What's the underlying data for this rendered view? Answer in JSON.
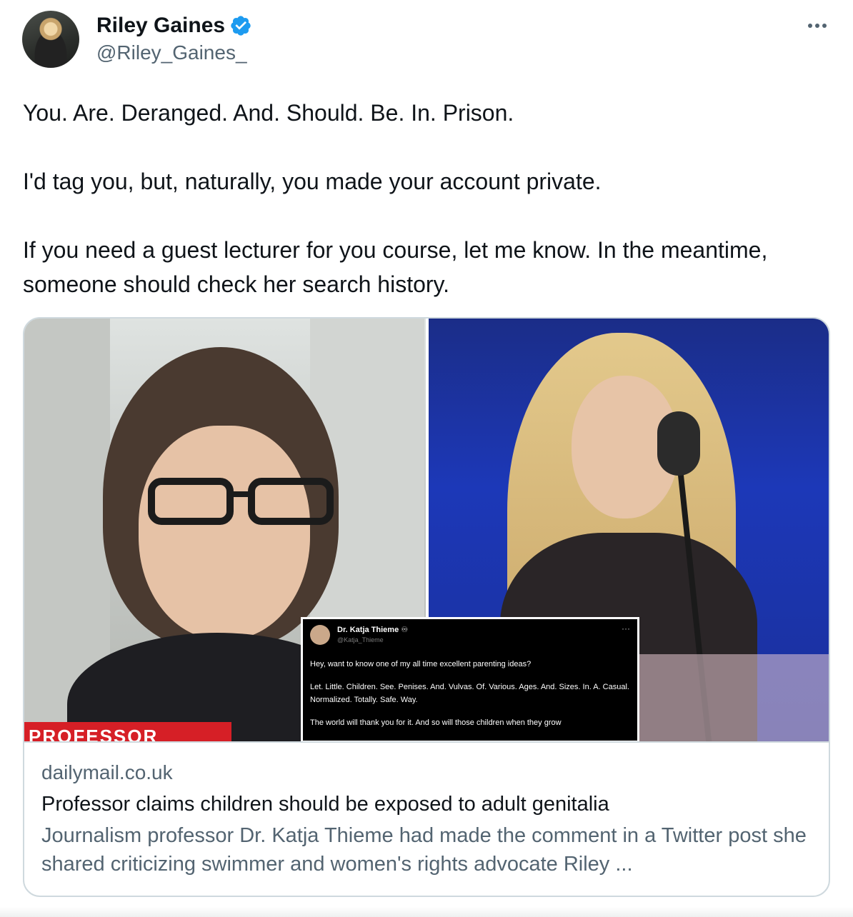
{
  "author": {
    "display_name": "Riley Gaines",
    "handle": "@Riley_Gaines_",
    "verified": true,
    "avatar_icon": "avatar-photo"
  },
  "tweet": {
    "paragraphs": [
      "You. Are. Deranged. And. Should. Be. In. Prison.",
      "I'd tag you, but, naturally, you made your account private.",
      "If you need a guest lecturer for you course, let me know. In the meantime, someone should check her search history."
    ]
  },
  "card": {
    "image_banner": "PROFESSOR",
    "embedded_tweet": {
      "name": "Dr. Katja Thieme ♾",
      "handle": "@Katja_Thieme",
      "lines": [
        "Hey, want to know one of my all time excellent parenting ideas?",
        "Let. Little. Children. See. Penises. And. Vulvas. Of. Various. Ages. And. Sizes. In. A. Casual. Normalized. Totally. Safe. Way.",
        "The world will thank you for it. And so will those children when they grow"
      ]
    },
    "domain": "dailymail.co.uk",
    "title": "Professor claims children should be exposed to adult genitalia",
    "description": "Journalism professor Dr. Katja Thieme had made the comment in a Twitter post she shared criticizing swimmer and women's rights advocate Riley ..."
  },
  "colors": {
    "text_primary": "#0f1419",
    "text_secondary": "#536471",
    "verified_blue": "#1d9bf0",
    "border": "#cfd9de"
  }
}
